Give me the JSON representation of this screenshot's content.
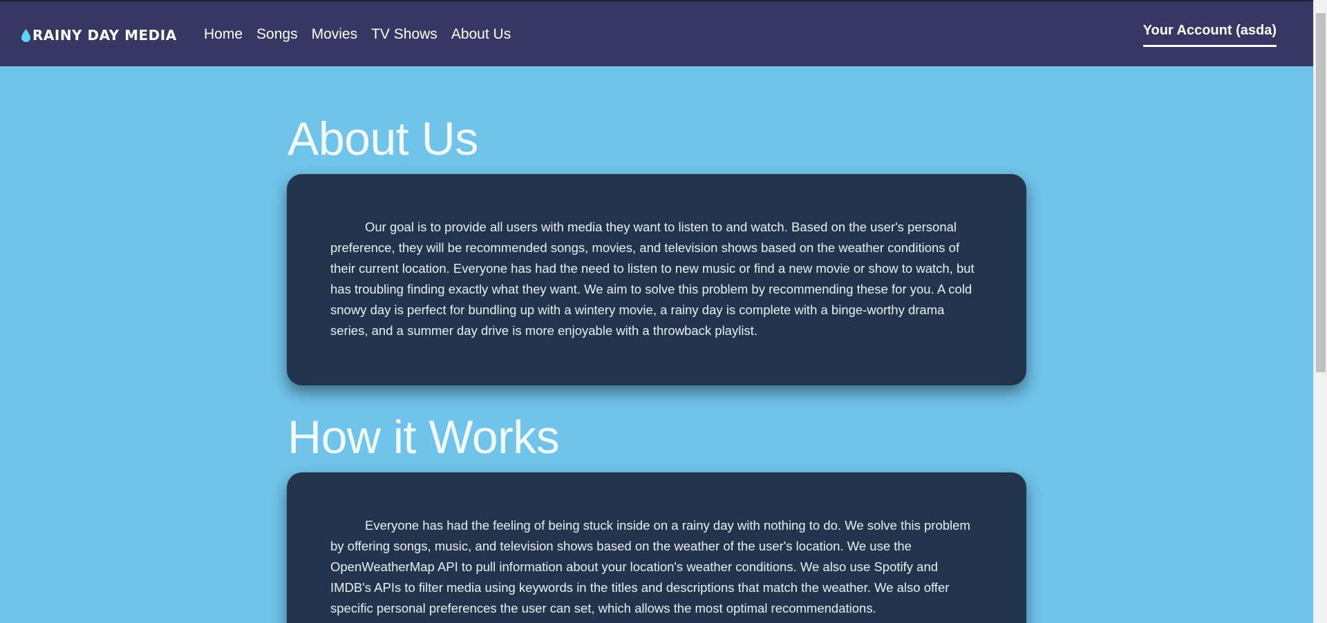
{
  "brand": {
    "name": "RAINY DAY MEDIA",
    "logo_icon": "raindrop-icon",
    "accent": "#5fd3f5"
  },
  "nav": {
    "items": [
      {
        "label": "Home"
      },
      {
        "label": "Songs"
      },
      {
        "label": "Movies"
      },
      {
        "label": "TV Shows"
      },
      {
        "label": "About Us"
      }
    ]
  },
  "account": {
    "label": "Your Account (asda)"
  },
  "sections": [
    {
      "title": "About Us",
      "body": "Our goal is to provide all users with media they want to listen to and watch. Based on the user's personal preference, they will be recommended songs, movies, and television shows based on the weather conditions of their current location. Everyone has had the need to listen to new music or find a new movie or show to watch, but has troubling finding exactly what they want. We aim to solve this problem by recommending these for you. A cold snowy day is perfect for bundling up with a wintery movie, a rainy day is complete with a binge-worthy drama series, and a summer day drive is more enjoyable with a throwback playlist."
    },
    {
      "title": "How it Works",
      "body": "Everyone has had the feeling of being stuck inside on a rainy day with nothing to do. We solve this problem by offering songs, music, and television shows based on the weather of the user's location. We use the OpenWeatherMap API to pull information about your location's weather conditions. We also use Spotify and IMDB's APIs to filter media using keywords in the titles and descriptions that match the weather. We also offer specific personal preferences the user can set, which allows the most optimal recommendations."
    }
  ],
  "colors": {
    "topbar": "#363762",
    "page_background": "#70c3ea",
    "card_background": "#23354d"
  }
}
